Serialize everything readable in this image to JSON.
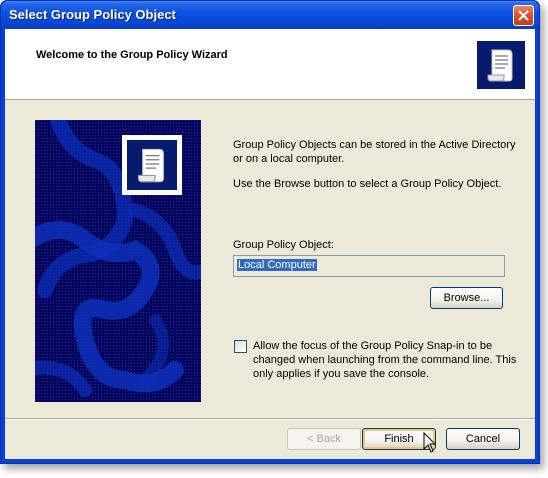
{
  "window": {
    "title": "Select Group Policy Object",
    "close_icon": "close-icon"
  },
  "header": {
    "title": "Welcome to the Group Policy Wizard",
    "icon": "scroll-document-icon"
  },
  "side_panel": {
    "icon": "scroll-document-icon"
  },
  "content": {
    "description_1": "Group Policy Objects can be stored in the Active Directory or on a local computer.",
    "description_2": "Use the Browse button to select a Group Policy Object.",
    "gpo_label": "Group Policy Object:",
    "gpo_value": "Local Computer",
    "browse_label": "Browse...",
    "checkbox_checked": false,
    "checkbox_label": "Allow the focus of the Group Policy Snap-in to be changed when launching from the command line.  This only applies if you save the console."
  },
  "footer": {
    "back_label": "< Back",
    "back_enabled": false,
    "finish_label": "Finish",
    "cancel_label": "Cancel"
  },
  "colors": {
    "title_bar": "#0b50e0",
    "client_bg": "#ece9d8",
    "side_panel_bg": "#03045e",
    "selection": "#316ac5",
    "close_button": "#d9532f"
  }
}
